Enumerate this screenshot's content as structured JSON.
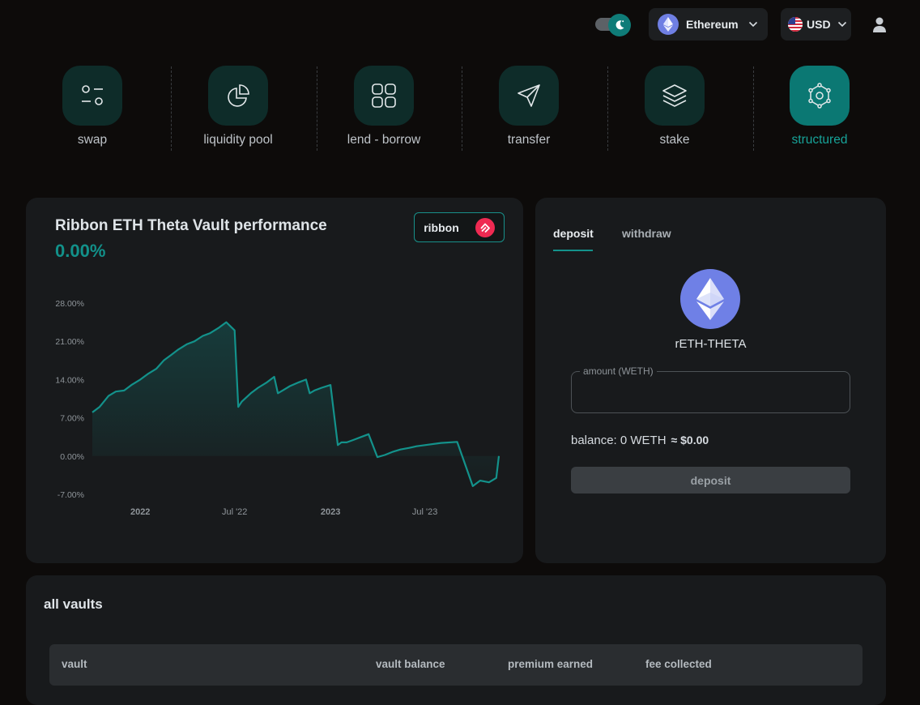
{
  "header": {
    "network": "Ethereum",
    "currency": "USD",
    "theme_toggle": "dark"
  },
  "actions": [
    {
      "label": "swap",
      "icon": "swap-icon",
      "active": false
    },
    {
      "label": "liquidity pool",
      "icon": "pie-chart-icon",
      "active": false
    },
    {
      "label": "lend - borrow",
      "icon": "grid-icon",
      "active": false
    },
    {
      "label": "transfer",
      "icon": "send-icon",
      "active": false
    },
    {
      "label": "stake",
      "icon": "layers-icon",
      "active": false
    },
    {
      "label": "structured",
      "icon": "atom-icon",
      "active": true
    }
  ],
  "performance": {
    "title": "Ribbon ETH Theta Vault performance",
    "change": "0.00%",
    "provider_button": "ribbon"
  },
  "chart_data": {
    "type": "area",
    "title": "Ribbon ETH Theta Vault performance",
    "xlabel": "",
    "ylabel": "",
    "x_ticks": [
      "2022",
      "Jul '22",
      "2023",
      "Jul '23"
    ],
    "y_ticks": [
      "28.00%",
      "21.00%",
      "14.00%",
      "7.00%",
      "0.00%",
      "-7.00%"
    ],
    "ylim": [
      -7,
      28
    ],
    "grid": false,
    "series": [
      {
        "x": [
          "2021-10-01",
          "2021-10-15",
          "2021-11-01",
          "2021-11-15",
          "2021-12-01",
          "2021-12-15",
          "2022-01-01",
          "2022-01-15",
          "2022-02-01",
          "2022-02-15",
          "2022-03-01",
          "2022-03-15",
          "2022-04-01",
          "2022-04-15",
          "2022-05-01",
          "2022-05-15",
          "2022-06-01",
          "2022-06-15",
          "2022-07-01",
          "2022-07-08",
          "2022-07-15",
          "2022-08-01",
          "2022-08-15",
          "2022-09-01",
          "2022-09-15",
          "2022-09-22",
          "2022-10-01",
          "2022-10-15",
          "2022-11-01",
          "2022-11-15",
          "2022-11-22",
          "2022-12-01",
          "2022-12-15",
          "2023-01-01",
          "2023-01-15",
          "2023-01-22",
          "2023-02-01",
          "2023-02-15",
          "2023-03-01",
          "2023-03-15",
          "2023-04-01",
          "2023-04-15",
          "2023-05-01",
          "2023-05-15",
          "2023-06-01",
          "2023-06-15",
          "2023-07-01",
          "2023-08-01",
          "2023-09-01",
          "2023-10-01",
          "2023-10-15",
          "2023-11-01",
          "2023-11-15",
          "2023-11-20"
        ],
        "y": [
          8.0,
          9.0,
          11.0,
          11.8,
          12.0,
          13.0,
          14.0,
          15.0,
          16.0,
          17.5,
          18.5,
          19.5,
          20.5,
          21.0,
          22.0,
          22.5,
          23.5,
          24.5,
          23.0,
          9.0,
          10.0,
          11.5,
          12.5,
          13.5,
          14.5,
          11.5,
          12.0,
          12.8,
          13.5,
          14.0,
          11.5,
          12.0,
          12.5,
          13.0,
          2.0,
          2.5,
          2.5,
          3.0,
          3.5,
          4.0,
          -0.2,
          0.2,
          0.8,
          1.2,
          1.5,
          1.8,
          2.0,
          2.4,
          2.6,
          -5.5,
          -4.5,
          -4.8,
          -4.0,
          0.0
        ]
      }
    ]
  },
  "deposit_panel": {
    "tabs": [
      "deposit",
      "withdraw"
    ],
    "active_tab": "deposit",
    "vault_token": "rETH-THETA",
    "amount_label": "amount (WETH)",
    "amount_value": "",
    "balance_text": "balance: 0 WETH",
    "balance_usd": "≈ $0.00",
    "deposit_button": "deposit"
  },
  "vaults": {
    "title": "all vaults",
    "columns": [
      "vault",
      "vault balance",
      "premium earned",
      "fee collected"
    ]
  },
  "colors": {
    "accent": "#13928b",
    "background": "#0d0b0a",
    "card": "#181a1c",
    "tile": "#0e2c29",
    "tile_active": "#0b7873"
  }
}
